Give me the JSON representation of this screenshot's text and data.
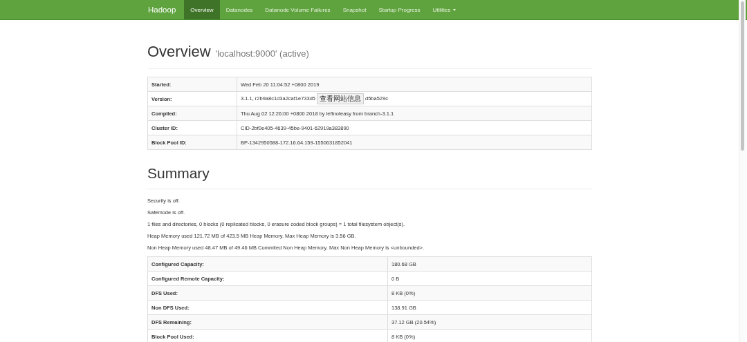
{
  "navbar": {
    "brand": "Hadoop",
    "items": [
      {
        "label": "Overview",
        "selected": true
      },
      {
        "label": "Datanodes",
        "selected": false
      },
      {
        "label": "Datanode Volume Failures",
        "selected": false
      },
      {
        "label": "Snapshot",
        "selected": false
      },
      {
        "label": "Startup Progress",
        "selected": false
      },
      {
        "label": "Utilities",
        "selected": false,
        "dropdown": true
      }
    ]
  },
  "overview": {
    "title": "Overview",
    "subtitle": "'localhost:9000' (active)",
    "rows": [
      {
        "label": "Started:",
        "value": "Wed Feb 20 11:04:52 +0800 2019"
      },
      {
        "label": "Version:",
        "value": "3.1.1, r2b9a8c1d3a2caf1e733d5",
        "tooltip": "查看网站信息",
        "value_after": "d5ba529c"
      },
      {
        "label": "Compiled:",
        "value": "Thu Aug 02 12:26:00 +0800 2018 by leftnoteasy from branch-3.1.1"
      },
      {
        "label": "Cluster ID:",
        "value": "CID-2bf0e405-4639-45be-9401-62919a383890"
      },
      {
        "label": "Block Pool ID:",
        "value": "BP-1342950588-172.16.64.159-1550631852041"
      }
    ]
  },
  "summary": {
    "title": "Summary",
    "lines": [
      "Security is off.",
      "Safemode is off.",
      "1 files and directories, 0 blocks (0 replicated blocks, 0 erasure coded block groups) = 1 total filesystem object(s).",
      "Heap Memory used 121.72 MB of 423.5 MB Heap Memory. Max Heap Memory is 3.56 GB.",
      "Non Heap Memory used 48.47 MB of 49.46 MB Commited Non Heap Memory. Max Non Heap Memory is <unbounded>."
    ],
    "rows": [
      {
        "label": "Configured Capacity:",
        "value": "180.68 GB"
      },
      {
        "label": "Configured Remote Capacity:",
        "value": "0 B"
      },
      {
        "label": "DFS Used:",
        "value": "8 KB (0%)"
      },
      {
        "label": "Non DFS Used:",
        "value": "138.91 GB"
      },
      {
        "label": "DFS Remaining:",
        "value": "37.12 GB (20.54%)"
      },
      {
        "label": "Block Pool Used:",
        "value": "8 KB (0%)"
      }
    ]
  }
}
